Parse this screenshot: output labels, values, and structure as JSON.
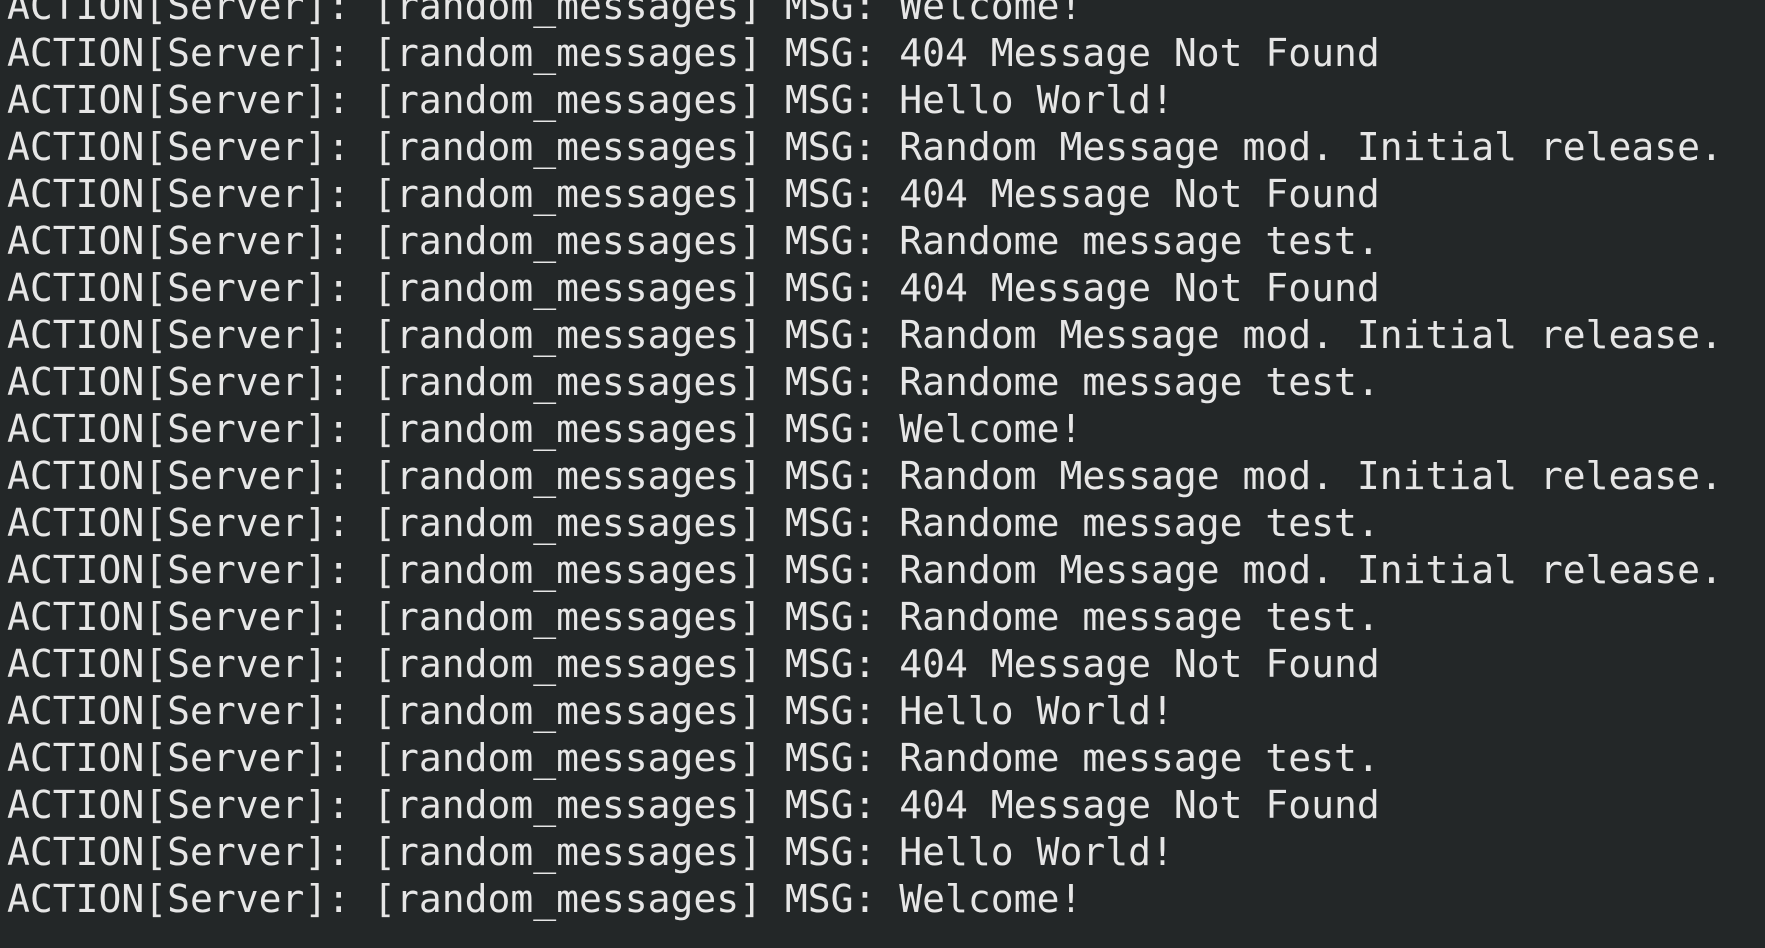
{
  "terminal": {
    "background_color": "#232728",
    "text_color": "#e6e6e6",
    "lines": [
      {
        "prefix": "ACTION[Server]:",
        "tag": "[random_messages]",
        "label": "MSG:",
        "message": "Welcome!"
      },
      {
        "prefix": "ACTION[Server]:",
        "tag": "[random_messages]",
        "label": "MSG:",
        "message": "404 Message Not Found"
      },
      {
        "prefix": "ACTION[Server]:",
        "tag": "[random_messages]",
        "label": "MSG:",
        "message": "Hello World!"
      },
      {
        "prefix": "ACTION[Server]:",
        "tag": "[random_messages]",
        "label": "MSG:",
        "message": "Random Message mod. Initial release."
      },
      {
        "prefix": "ACTION[Server]:",
        "tag": "[random_messages]",
        "label": "MSG:",
        "message": "404 Message Not Found"
      },
      {
        "prefix": "ACTION[Server]:",
        "tag": "[random_messages]",
        "label": "MSG:",
        "message": "Randome message test."
      },
      {
        "prefix": "ACTION[Server]:",
        "tag": "[random_messages]",
        "label": "MSG:",
        "message": "404 Message Not Found"
      },
      {
        "prefix": "ACTION[Server]:",
        "tag": "[random_messages]",
        "label": "MSG:",
        "message": "Random Message mod. Initial release."
      },
      {
        "prefix": "ACTION[Server]:",
        "tag": "[random_messages]",
        "label": "MSG:",
        "message": "Randome message test."
      },
      {
        "prefix": "ACTION[Server]:",
        "tag": "[random_messages]",
        "label": "MSG:",
        "message": "Welcome!"
      },
      {
        "prefix": "ACTION[Server]:",
        "tag": "[random_messages]",
        "label": "MSG:",
        "message": "Random Message mod. Initial release."
      },
      {
        "prefix": "ACTION[Server]:",
        "tag": "[random_messages]",
        "label": "MSG:",
        "message": "Randome message test."
      },
      {
        "prefix": "ACTION[Server]:",
        "tag": "[random_messages]",
        "label": "MSG:",
        "message": "Random Message mod. Initial release."
      },
      {
        "prefix": "ACTION[Server]:",
        "tag": "[random_messages]",
        "label": "MSG:",
        "message": "Randome message test."
      },
      {
        "prefix": "ACTION[Server]:",
        "tag": "[random_messages]",
        "label": "MSG:",
        "message": "404 Message Not Found"
      },
      {
        "prefix": "ACTION[Server]:",
        "tag": "[random_messages]",
        "label": "MSG:",
        "message": "Hello World!"
      },
      {
        "prefix": "ACTION[Server]:",
        "tag": "[random_messages]",
        "label": "MSG:",
        "message": "Randome message test."
      },
      {
        "prefix": "ACTION[Server]:",
        "tag": "[random_messages]",
        "label": "MSG:",
        "message": "404 Message Not Found"
      },
      {
        "prefix": "ACTION[Server]:",
        "tag": "[random_messages]",
        "label": "MSG:",
        "message": "Hello World!"
      },
      {
        "prefix": "ACTION[Server]:",
        "tag": "[random_messages]",
        "label": "MSG:",
        "message": "Welcome!"
      }
    ]
  }
}
